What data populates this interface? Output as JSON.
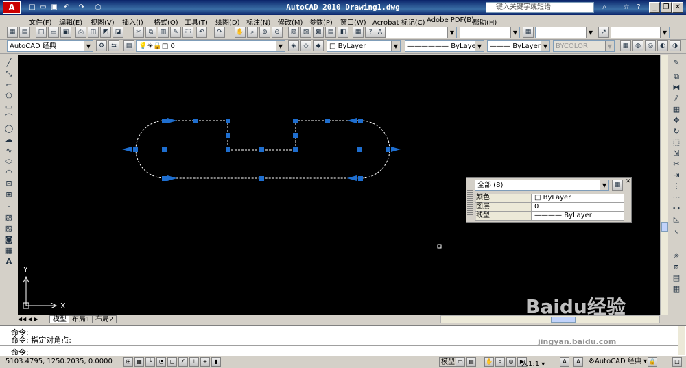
{
  "titlebar": {
    "title": "AutoCAD 2010   Drawing1.dwg",
    "search_placeholder": "键入关键字或短语",
    "minimize": "_",
    "restore": "❐",
    "close": "✕"
  },
  "menu": [
    "文件(F)",
    "编辑(E)",
    "视图(V)",
    "插入(I)",
    "格式(O)",
    "工具(T)",
    "绘图(D)",
    "标注(N)",
    "修改(M)",
    "参数(P)",
    "窗口(W)",
    "Acrobat 标记(C)",
    "Adobe PDF(B)",
    "帮助(H)"
  ],
  "toolbar2": {
    "workspace": "AutoCAD 经典",
    "layer": "0",
    "color": "ByLayer",
    "linetype": "ByLayer",
    "lineweight": "ByLayer",
    "plotstyle": "BYCOLOR"
  },
  "properties_panel": {
    "selection": "全部 (8)",
    "rows": [
      {
        "label": "颜色",
        "value": "ByLayer"
      },
      {
        "label": "图层",
        "value": "0"
      },
      {
        "label": "线型",
        "value": "ByLayer"
      }
    ]
  },
  "ucs": {
    "x_label": "X",
    "y_label": "Y"
  },
  "tabs": [
    "模型",
    "布局1",
    "布局2"
  ],
  "command": {
    "line1": "命令:",
    "line2": "命令: 指定对角点:",
    "prompt": "命令:"
  },
  "status": {
    "coordinates": "5103.4795, 1250.2035, 0.0000",
    "model_label": "模型",
    "scale": "人1:1",
    "workspace": "AutoCAD 经典"
  },
  "watermark": {
    "brand": "Baidu",
    "brand_cn": "经验",
    "url": "jingyan.baidu.com"
  },
  "colors": {
    "grip": "#1e6ecf",
    "canvas": "#000000",
    "titlebar": "#0b246a"
  }
}
